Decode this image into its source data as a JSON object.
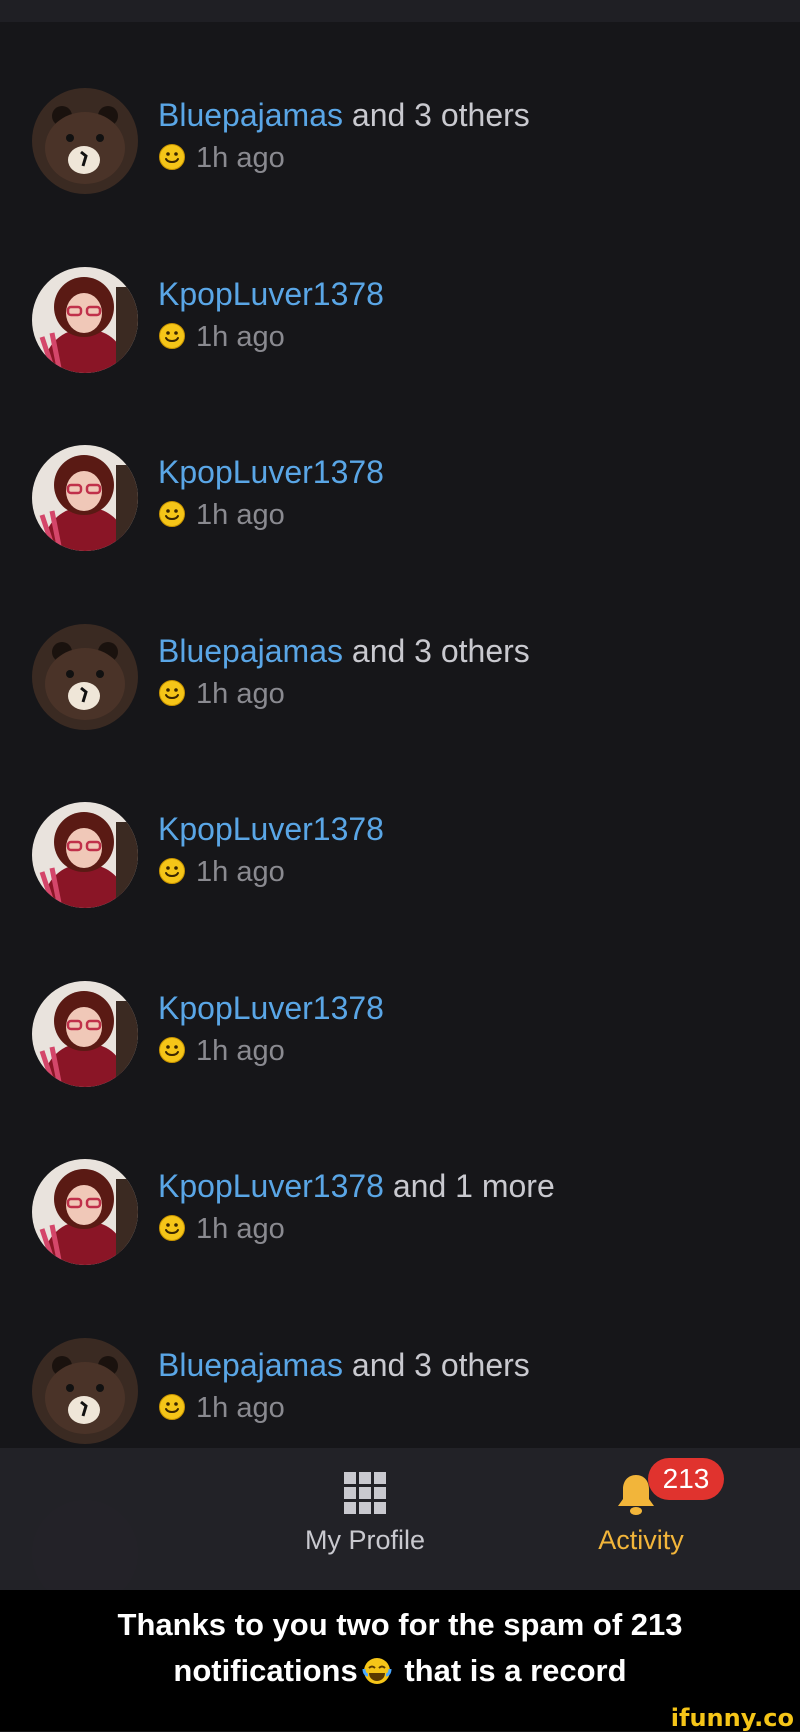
{
  "notifications": [
    {
      "avatar": "bear-avatar",
      "user": "Bluepajamas",
      "rest": " and 3 others",
      "emoji": "smiley-icon",
      "time": "1h ago"
    },
    {
      "avatar": "girl-avatar",
      "user": "KpopLuver1378",
      "rest": "",
      "emoji": "smiley-icon",
      "time": "1h ago"
    },
    {
      "avatar": "girl-avatar",
      "user": "KpopLuver1378",
      "rest": "",
      "emoji": "smiley-icon",
      "time": "1h ago"
    },
    {
      "avatar": "bear-avatar",
      "user": "Bluepajamas",
      "rest": " and 3 others",
      "emoji": "smiley-icon",
      "time": "1h ago"
    },
    {
      "avatar": "girl-avatar",
      "user": "KpopLuver1378",
      "rest": "",
      "emoji": "smiley-icon",
      "time": "1h ago"
    },
    {
      "avatar": "girl-avatar",
      "user": "KpopLuver1378",
      "rest": "",
      "emoji": "smiley-icon",
      "time": "1h ago"
    },
    {
      "avatar": "girl-avatar",
      "user": "KpopLuver1378",
      "rest": " and 1 more",
      "emoji": "smiley-icon",
      "time": "1h ago"
    },
    {
      "avatar": "bear-avatar",
      "user": "Bluepajamas",
      "rest": " and 3 others",
      "emoji": "smiley-icon",
      "time": "1h ago"
    }
  ],
  "tabbar": {
    "profile_label": "My Profile",
    "profile_icon": "grid-icon",
    "activity_label": "Activity",
    "activity_icon": "bell-icon",
    "activity_badge": "213",
    "accent_color": "#f2b53a",
    "badge_color": "#e0332e"
  },
  "caption": {
    "line1": "Thanks to you two for the spam of 213",
    "line2_a": "notifications",
    "line2_emoji": "laughing-tears-icon",
    "line2_b": " that is a record"
  },
  "watermark": "ifunny.co"
}
